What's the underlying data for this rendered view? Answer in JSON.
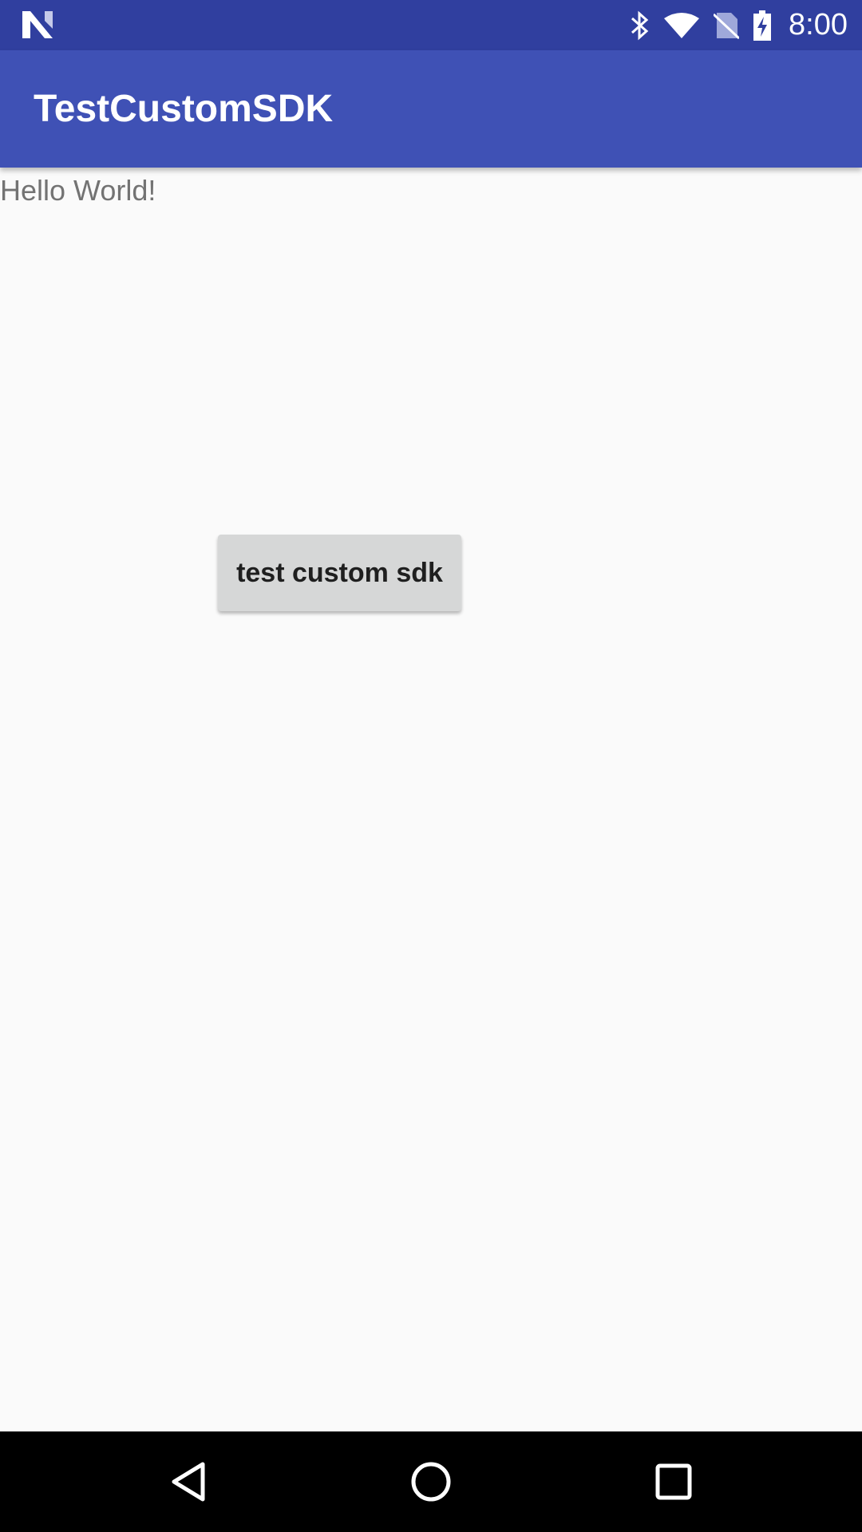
{
  "status_bar": {
    "time": "8:00",
    "background_color": "#303f9f",
    "icons": [
      "notification-n-icon",
      "bluetooth-icon",
      "wifi-icon",
      "no-sim-icon",
      "battery-charging-icon"
    ]
  },
  "app_bar": {
    "title": "TestCustomSDK",
    "background_color": "#3f51b5"
  },
  "content": {
    "hello_text": "Hello World!",
    "button_label": "test custom sdk"
  },
  "nav_bar": {
    "buttons": [
      "back-icon",
      "home-icon",
      "recents-icon"
    ]
  }
}
